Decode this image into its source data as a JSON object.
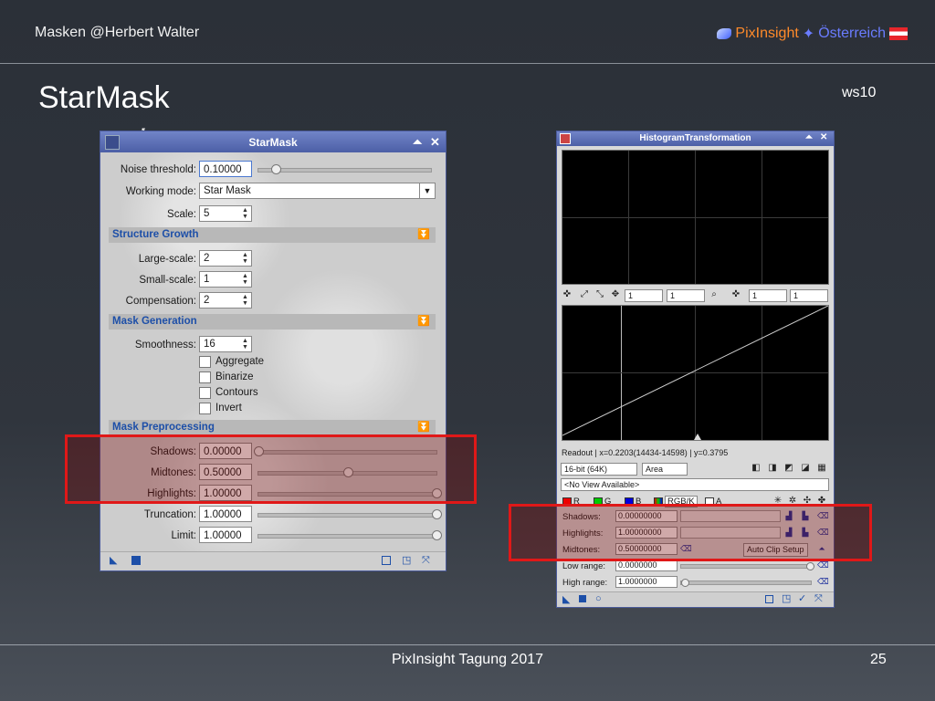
{
  "slide": {
    "header_left": "Masken  @Herbert Walter",
    "brand_pixinsight": "PixInsight",
    "brand_austria": "Österreich",
    "title": "StarMask",
    "tag": "ws10",
    "footer": "PixInsight Tagung 2017",
    "page": "25"
  },
  "starmask": {
    "title": "StarMask",
    "noise_threshold_label": "Noise threshold:",
    "noise_threshold_value": "0.10000",
    "working_mode_label": "Working mode:",
    "working_mode_value": "Star Mask",
    "scale_label": "Scale:",
    "scale_value": "5",
    "structure_growth": "Structure Growth",
    "large_scale_label": "Large-scale:",
    "large_scale_value": "2",
    "small_scale_label": "Small-scale:",
    "small_scale_value": "1",
    "compensation_label": "Compensation:",
    "compensation_value": "2",
    "mask_generation": "Mask Generation",
    "smoothness_label": "Smoothness:",
    "smoothness_value": "16",
    "checkboxes": [
      "Aggregate",
      "Binarize",
      "Contours",
      "Invert"
    ],
    "mask_preprocessing": "Mask Preprocessing",
    "shadows_label": "Shadows:",
    "shadows_value": "0.00000",
    "midtones_label": "Midtones:",
    "midtones_value": "0.50000",
    "highlights_label": "Highlights:",
    "highlights_value": "1.00000",
    "truncation_label": "Truncation:",
    "truncation_value": "1.00000",
    "limit_label": "Limit:",
    "limit_value": "1.00000",
    "sliders": {
      "noise_threshold": 0.1,
      "shadows": 0.0,
      "midtones": 0.5,
      "highlights": 1.0,
      "truncation": 1.0,
      "limit": 1.0
    }
  },
  "histogram": {
    "title": "HistogramTransformation",
    "zoom_h1": "1",
    "zoom_v1": "1",
    "zoom_h2": "1",
    "zoom_v2": "1",
    "readout": "Readout | x=0.2203(14434-14598) | y=0.3795",
    "bit_depth": "16-bit (64K)",
    "graph_style": "Area",
    "view": "<No View Available>",
    "channels": [
      "R",
      "G",
      "B",
      "RGB/K",
      "A"
    ],
    "shadows_label": "Shadows:",
    "shadows_value": "0.00000000",
    "highlights_label": "Highlights:",
    "highlights_value": "1.00000000",
    "midtones_label": "Midtones:",
    "midtones_value": "0.50000000",
    "auto_clip_label": "Auto Clip Setup",
    "low_range_label": "Low range:",
    "low_range_value": "0.0000000",
    "high_range_label": "High range:",
    "high_range_value": "1.0000000"
  },
  "colors": {
    "highlight_border": "#e01818",
    "window_title": "#4c5fa6",
    "section_text": "#1d4fa8"
  }
}
